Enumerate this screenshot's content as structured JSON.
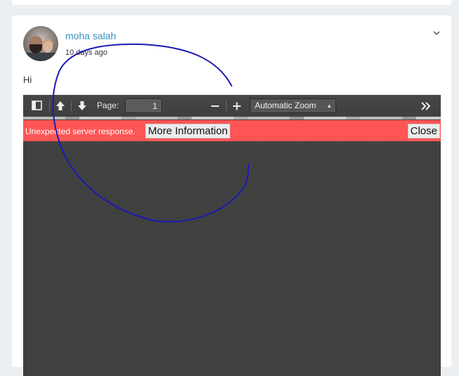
{
  "post": {
    "author": "moha salah",
    "time": "10 days ago",
    "message": "Hi"
  },
  "pdf_viewer": {
    "page_label": "Page:",
    "page_value": "1",
    "zoom": "Automatic Zoom",
    "error_text": "Unexpected server response.",
    "more_info_label": "More Information",
    "close_label": "Close"
  },
  "colors": {
    "author_link": "#3d8fc2",
    "error_bar": "#ff5555",
    "toolbar": "#474747",
    "viewer_bg": "#404040",
    "scribble": "#1a1ab4"
  },
  "icons": [
    "sidebar-toggle-icon",
    "previous-page-icon",
    "next-page-icon",
    "zoom-out-icon",
    "zoom-in-icon",
    "tools-icon",
    "chevron-down-icon"
  ]
}
